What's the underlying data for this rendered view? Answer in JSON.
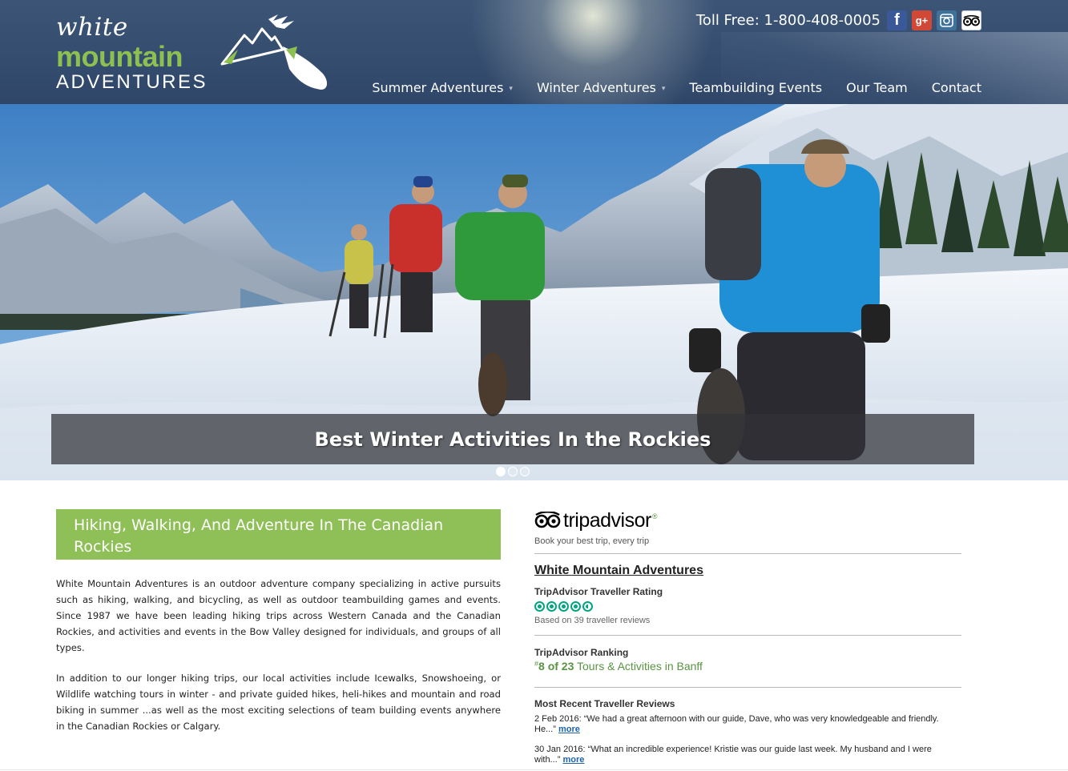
{
  "logo": {
    "line1": "white",
    "line2": "mountain",
    "line3": "ADVENTURES"
  },
  "topbar": {
    "toll_free": "Toll Free: 1-800-408-0005",
    "social_icons": [
      "facebook-icon",
      "google-plus-icon",
      "instagram-icon",
      "tripadvisor-icon"
    ],
    "facebook_glyph": "f",
    "googleplus_glyph": "g+"
  },
  "nav": {
    "items": [
      {
        "label": "Summer Adventures",
        "has_dropdown": true
      },
      {
        "label": "Winter Adventures",
        "has_dropdown": true
      },
      {
        "label": "Teambuilding Events",
        "has_dropdown": false
      },
      {
        "label": "Our Team",
        "has_dropdown": false
      },
      {
        "label": "Contact",
        "has_dropdown": false
      }
    ],
    "caret": "▾"
  },
  "hero": {
    "caption": "Best Winter Activities In the Rockies",
    "slides_total": 3,
    "active_slide": 1
  },
  "main": {
    "heading": "Hiking, Walking, And Adventure In The Canadian Rockies",
    "paragraph1": "White Mountain Adventures is an outdoor adventure company specializing in active pursuits such as hiking, walking, and bicycling, as well as outdoor teambuilding games and events.  Since 1987 we have been leading hiking trips across Western Canada and the Canadian Rockies, and activities and events in the Bow Valley designed for individuals, and groups of all types.",
    "paragraph2": "In addition to our longer hiking trips, our local activities include Icewalks, Snowshoeing, or Wildlife watching tours in winter - and private guided hikes, heli-hikes and mountain and road biking in summer ...as well as the most exciting selections of team building events anywhere in the Canadian Rockies or Calgary."
  },
  "tripadvisor": {
    "wordmark": "tripadvisor",
    "registered": "®",
    "tagline": "Book your best trip, every trip",
    "business_name": "White Mountain Adventures",
    "rating_label": "TripAdvisor Traveller Rating",
    "rating_value": 4.5,
    "based_on": "Based on 39 traveller reviews",
    "ranking_label": "TripAdvisor Ranking",
    "rank_hash": "#",
    "rank_position": "8 of 23",
    "rank_suffix": " Tours & Activities in Banff",
    "recent_label": "Most Recent Traveller Reviews",
    "reviews": [
      {
        "text": "2 Feb 2016: “We had a great afternoon with our guide, Dave, who was very knowledgeable and friendly. He...” ",
        "more": "more"
      },
      {
        "text": "30 Jan 2016: “What an incredible experience! Kristie was our guide last week. My husband and I were with...” ",
        "more": "more"
      }
    ]
  },
  "colors": {
    "header_bg": "#344c6e",
    "brand_green": "#8fbf57",
    "tripadvisor_green": "#00a680",
    "link_blue": "#1e63a8"
  }
}
